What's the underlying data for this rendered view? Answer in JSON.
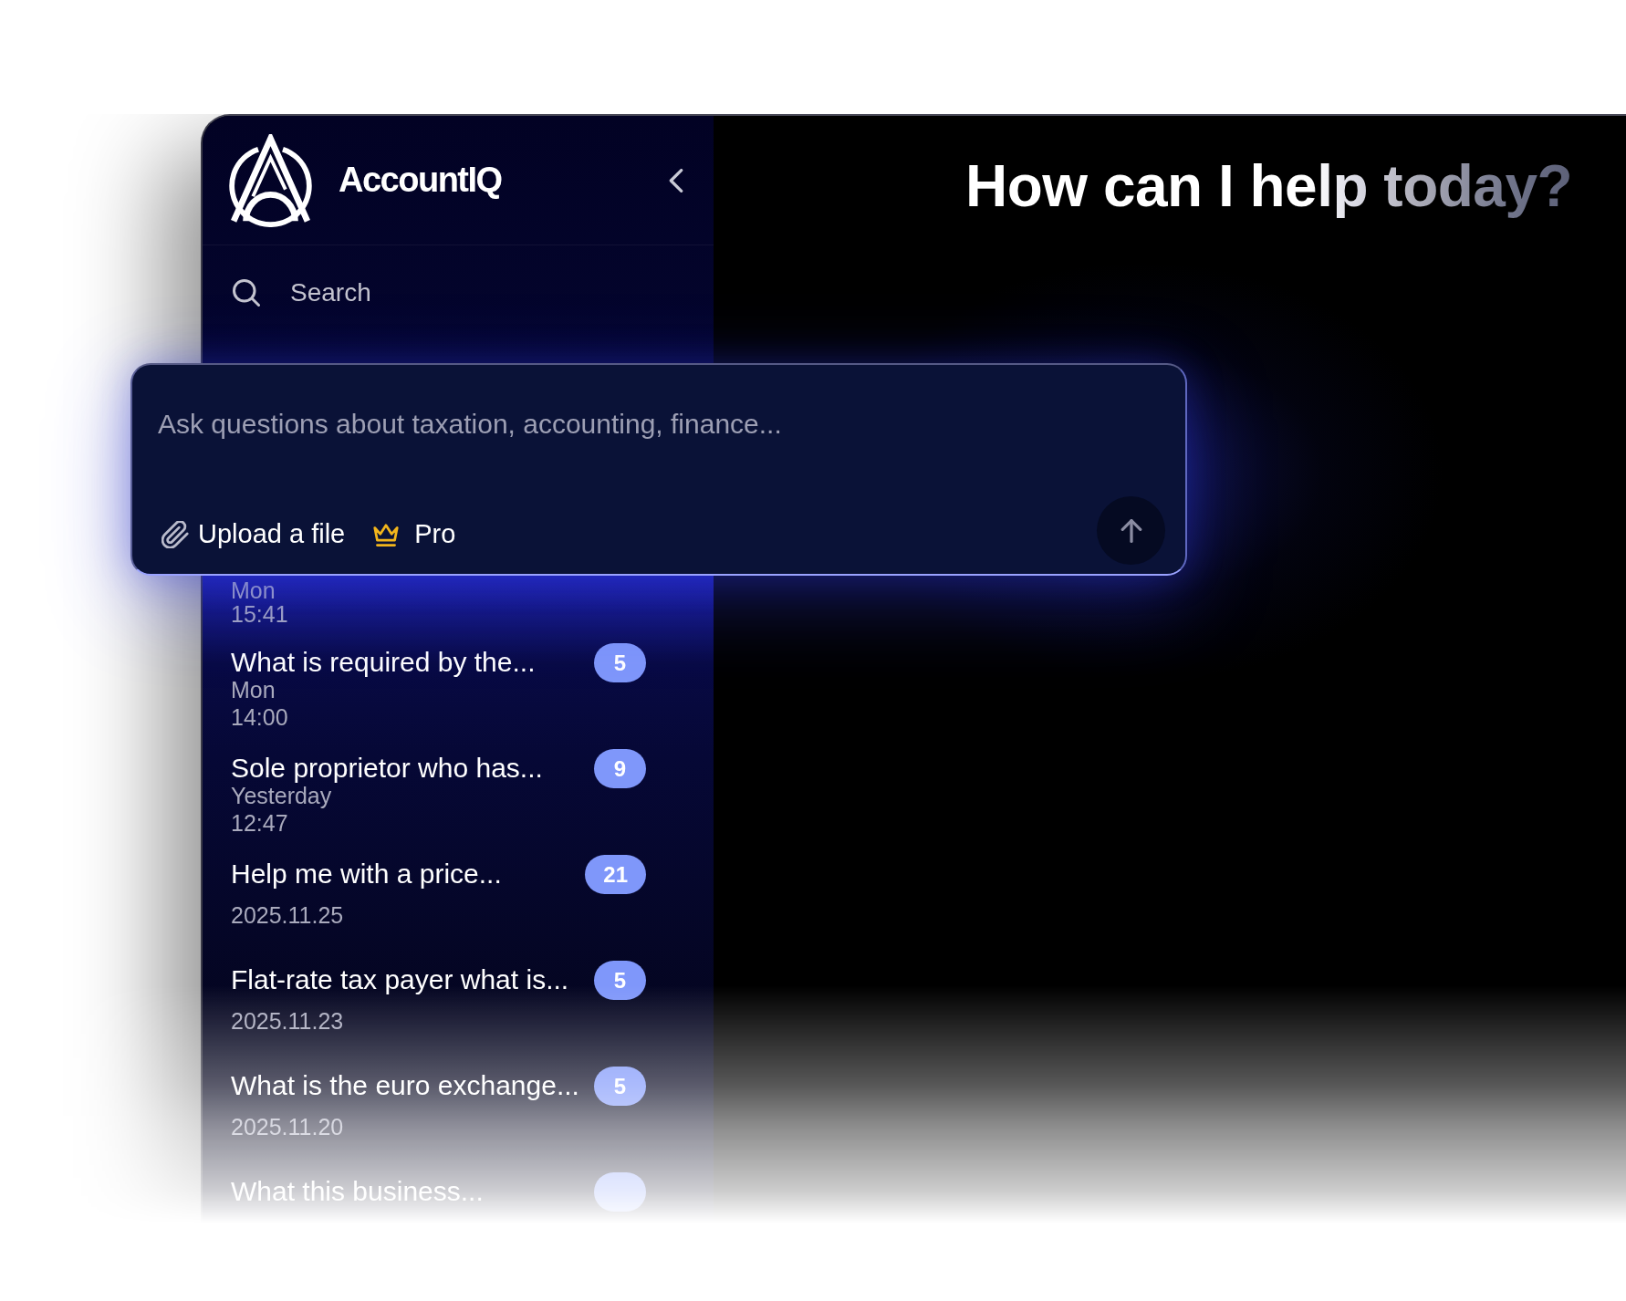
{
  "sidebar": {
    "brand": "AccountIQ",
    "nav": [
      {
        "kind": "search",
        "label": "Search"
      }
    ],
    "chats": [
      {
        "date": "Mon",
        "time": "15:41"
      },
      {
        "title": "What is required by the...",
        "count": "5",
        "date": "Mon",
        "time": "14:00"
      },
      {
        "title": "Sole proprietor who has...",
        "count": "9",
        "date": "Yesterday",
        "time": "12:47"
      },
      {
        "title": "Help me with a price...",
        "count": "21",
        "date": "2025.11.25"
      },
      {
        "title": "Flat-rate tax payer what is...",
        "count": "5",
        "date": "2025.11.23"
      },
      {
        "title": "What is the euro exchange...",
        "count": "5",
        "date": "2025.11.20"
      },
      {
        "title": "What this business..."
      }
    ]
  },
  "main": {
    "heading": "How can I help today?"
  },
  "composer": {
    "placeholder": "Ask questions about taxation, accounting, finance...",
    "actions": [
      {
        "kind": "upload",
        "label": "Upload a file"
      },
      {
        "kind": "pro",
        "label": "Pro"
      }
    ]
  }
}
